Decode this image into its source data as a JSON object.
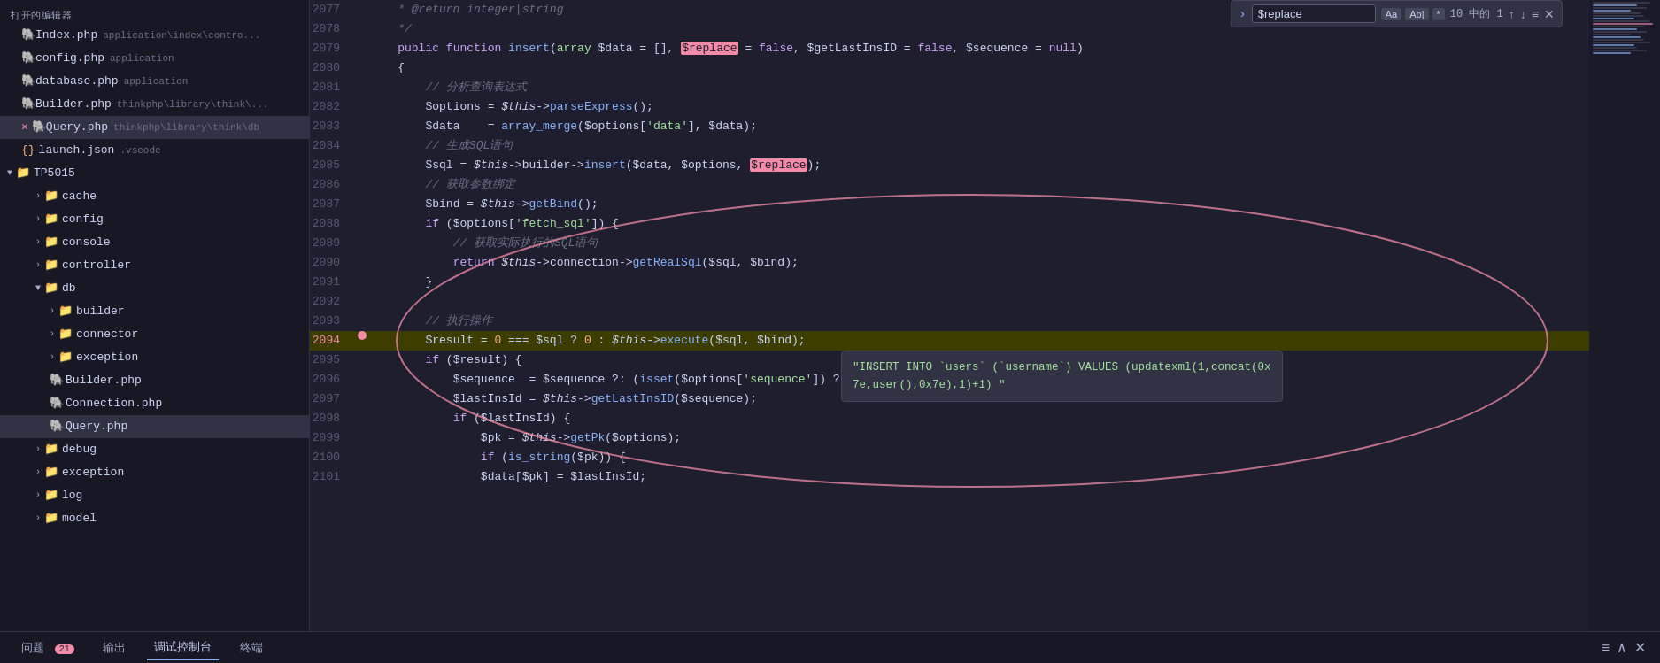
{
  "sidebar": {
    "files": [
      {
        "name": "Index.php",
        "path": "application\\index\\contro...",
        "icon": "php",
        "indent": 0,
        "modified": false
      },
      {
        "name": "config.php",
        "path": "application",
        "icon": "php",
        "indent": 0,
        "modified": false
      },
      {
        "name": "database.php",
        "path": "application",
        "icon": "php",
        "indent": 0,
        "modified": false
      },
      {
        "name": "Builder.php",
        "path": "thinkphp\\library\\think\\...",
        "icon": "php",
        "indent": 0,
        "modified": false
      },
      {
        "name": "Query.php",
        "path": "thinkphp\\library\\think\\db",
        "icon": "php",
        "indent": 0,
        "modified": true,
        "closed": true
      },
      {
        "name": "launch.json",
        "path": ".vscode",
        "icon": "json",
        "indent": 0,
        "modified": false
      }
    ],
    "tp5015": {
      "label": "TP5015",
      "folders": [
        {
          "name": "cache",
          "indent": 1,
          "open": false
        },
        {
          "name": "config",
          "indent": 1,
          "open": false
        },
        {
          "name": "console",
          "indent": 1,
          "open": false
        },
        {
          "name": "controller",
          "indent": 1,
          "open": false
        },
        {
          "name": "db",
          "indent": 1,
          "open": true,
          "children": [
            {
              "name": "builder",
              "indent": 2,
              "open": false
            },
            {
              "name": "connector",
              "indent": 2,
              "open": false
            },
            {
              "name": "exception",
              "indent": 2,
              "open": false
            },
            {
              "name": "Builder.php",
              "indent": 2,
              "icon": "php"
            },
            {
              "name": "Connection.php",
              "indent": 2,
              "icon": "php"
            },
            {
              "name": "Query.php",
              "indent": 2,
              "icon": "php",
              "active": true
            }
          ]
        },
        {
          "name": "debug",
          "indent": 1,
          "open": false
        },
        {
          "name": "exception",
          "indent": 1,
          "open": false
        },
        {
          "name": "log",
          "indent": 1,
          "open": false
        },
        {
          "name": "model",
          "indent": 1,
          "open": false
        }
      ]
    }
  },
  "find_widget": {
    "arrow": "›",
    "input_value": "$replace",
    "option_aa": "Aa",
    "option_ab": "Ab|",
    "option_regex": "*",
    "count": "10 中的 1",
    "nav_up": "↑",
    "nav_down": "↓",
    "nav_list": "≡",
    "close": "✕"
  },
  "code_lines": [
    {
      "num": 2077,
      "content": "    * @return integer|string"
    },
    {
      "num": 2078,
      "content": "    */"
    },
    {
      "num": 2079,
      "content": "    public function insert(array $data = [], $replace = false, $getLastInsID = false, $sequence = null)"
    },
    {
      "num": 2080,
      "content": "    {"
    },
    {
      "num": 2081,
      "content": "        // 分析查询表达式"
    },
    {
      "num": 2082,
      "content": "        $options = $this->parseExpress();"
    },
    {
      "num": 2083,
      "content": "        $data    = array_merge($options['data'], $data);"
    },
    {
      "num": 2084,
      "content": "        // 生成SQL语句"
    },
    {
      "num": 2085,
      "content": "        $sql = $this->builder->insert($data, $options, $replace);"
    },
    {
      "num": 2086,
      "content": "        // 获取参数绑定"
    },
    {
      "num": 2087,
      "content": "        $bind = $this->getBind();"
    },
    {
      "num": 2088,
      "content": "        if ($options['fetch_sql']) {"
    },
    {
      "num": 2089,
      "content": "            // 获取实际执行的SQL语句"
    },
    {
      "num": 2090,
      "content": "            return $this->connection->getRealSql($sql, $bind);"
    },
    {
      "num": 2091,
      "content": "        }"
    },
    {
      "num": 2092,
      "content": ""
    },
    {
      "num": 2093,
      "content": "        // 执行操作"
    },
    {
      "num": 2094,
      "content": "        $result = 0 === $sql ? 0 : $this->execute($sql, $bind);",
      "highlighted": true,
      "breakpoint": true
    },
    {
      "num": 2095,
      "content": "        if ($result) {"
    },
    {
      "num": 2096,
      "content": "            $sequence  = $sequence ?: (isset($options['sequence']) ? $options['sequence'] : null);"
    },
    {
      "num": 2097,
      "content": "            $lastInsId = $this->getLastInsID($sequence);"
    },
    {
      "num": 2098,
      "content": "            if ($lastInsId) {"
    },
    {
      "num": 2099,
      "content": "                $pk = $this->getPk($options);"
    },
    {
      "num": 2100,
      "content": "                if (is_string($pk)) {"
    },
    {
      "num": 2101,
      "content": "                $data[$pk] = $lastInsId;"
    }
  ],
  "tooltip": {
    "line1": "\"INSERT INTO `users` (`username`) VALUES (updatexml(1,concat(0x",
    "line2": "7e,user(),0x7e),1)+1) \""
  },
  "bottom_panel": {
    "tabs": [
      {
        "label": "问题",
        "badge": "21"
      },
      {
        "label": "输出"
      },
      {
        "label": "调试控制台",
        "active": true
      },
      {
        "label": "终端"
      }
    ]
  }
}
